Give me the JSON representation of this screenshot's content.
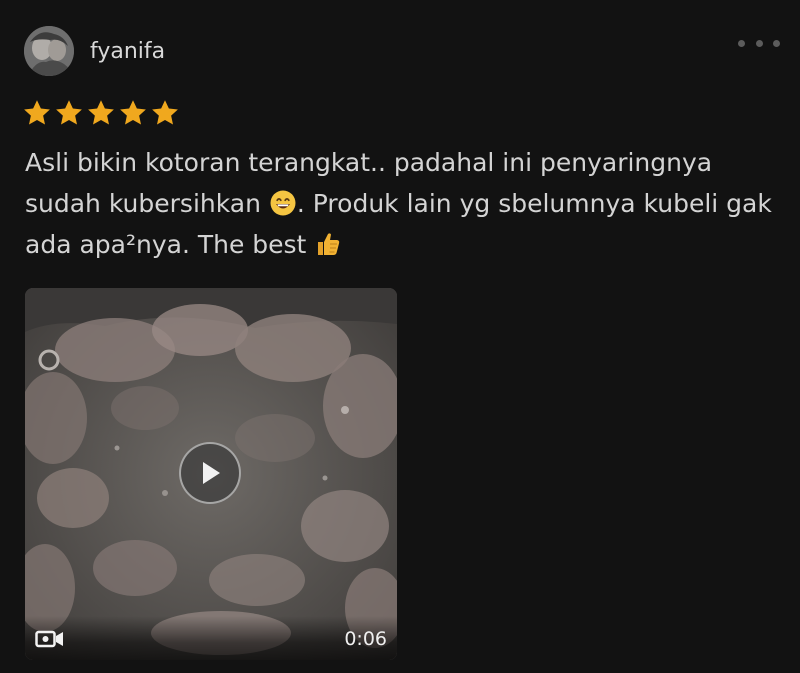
{
  "review": {
    "username": "fyanifa",
    "rating": 5,
    "max_rating": 5,
    "text_parts": [
      "Asli bikin kotoran terangkat.. padahal ini penyaringnya sudah kubersihkan ",
      ". Produk lain yg sbelumnya kubeli gak ada apa²nya. The best "
    ],
    "emojis": [
      "grinning-face-emoji",
      "thumbs-up-emoji"
    ],
    "colors": {
      "star": "#f0a81e",
      "background": "#121212",
      "text": "#d4d4d4"
    }
  },
  "media": {
    "type": "video",
    "icons": [
      "play-icon",
      "video-camera-icon"
    ],
    "duration": "0:06"
  },
  "menu": {
    "icon": "more-options-icon"
  }
}
